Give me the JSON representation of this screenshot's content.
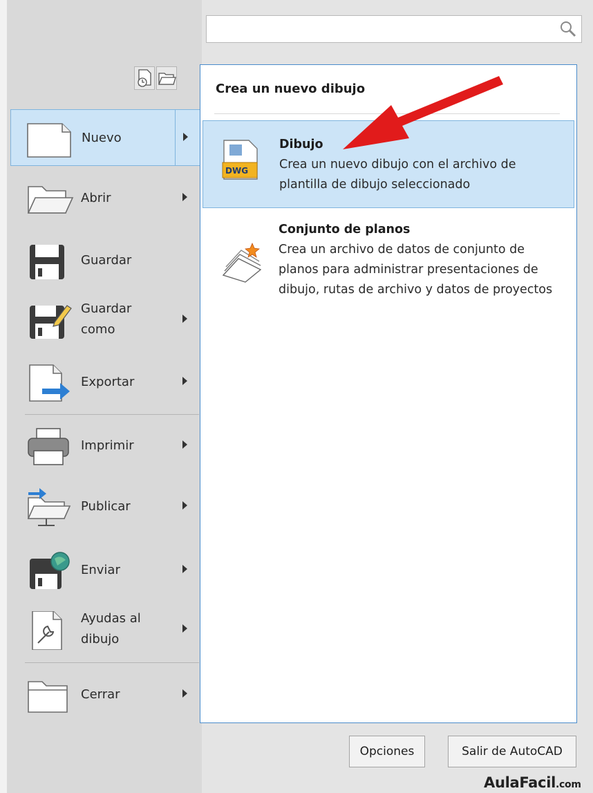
{
  "search": {
    "placeholder": ""
  },
  "menu": {
    "items": [
      {
        "label": "Nuevo",
        "icon": "new-document-icon",
        "has_submenu": true,
        "selected": true
      },
      {
        "label": "Abrir",
        "icon": "open-folder-icon",
        "has_submenu": true
      },
      {
        "label": "Guardar",
        "icon": "save-icon",
        "has_submenu": false
      },
      {
        "label": "Guardar\ncomo",
        "icon": "save-as-icon",
        "has_submenu": true
      },
      {
        "label": "Exportar",
        "icon": "export-icon",
        "has_submenu": true
      },
      {
        "label": "Imprimir",
        "icon": "print-icon",
        "has_submenu": true
      },
      {
        "label": "Publicar",
        "icon": "publish-icon",
        "has_submenu": true
      },
      {
        "label": "Enviar",
        "icon": "send-icon",
        "has_submenu": true
      },
      {
        "label": "Ayudas al\ndibujo",
        "icon": "drawing-utilities-icon",
        "has_submenu": true
      },
      {
        "label": "Cerrar",
        "icon": "close-folder-icon",
        "has_submenu": true
      }
    ]
  },
  "submenu": {
    "title": "Crea un nuevo dibujo",
    "items": [
      {
        "title": "Dibujo",
        "description": "Crea un nuevo dibujo con el archivo de plantilla de dibujo seleccionado",
        "icon": "dwg-file-icon",
        "selected": true,
        "icon_text": "DWG"
      },
      {
        "title": "Conjunto de planos",
        "description": "Crea un archivo de datos de conjunto de planos para administrar presentaciones de dibujo, rutas de archivo y datos de proyectos",
        "icon": "sheet-set-icon"
      }
    ]
  },
  "footer": {
    "options_label": "Opciones",
    "exit_label": "Salir de AutoCAD"
  },
  "watermark": {
    "main": "AulaFacil",
    "suffix": ".com"
  },
  "colors": {
    "selection_fill": "#cce4f7",
    "selection_border": "#7fb4de",
    "submenu_border": "#4a8ccc",
    "annotation_arrow": "#e11b1b"
  }
}
